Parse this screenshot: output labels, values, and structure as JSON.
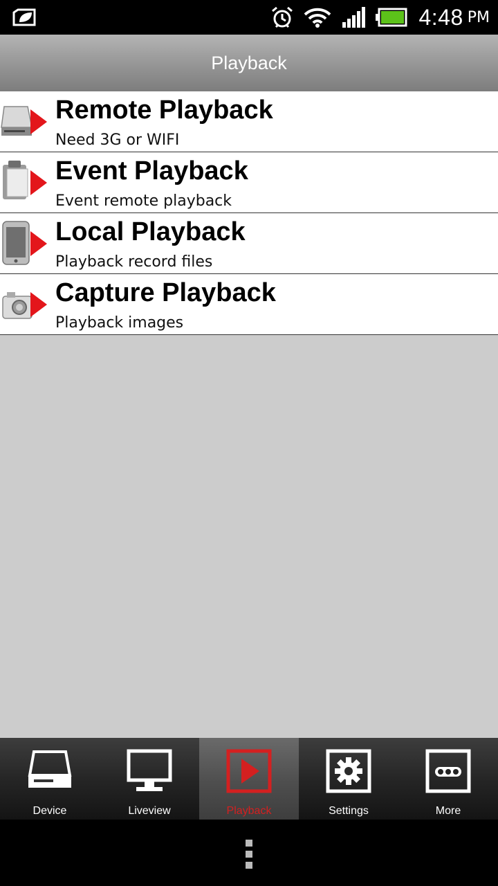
{
  "status_bar": {
    "time": "4:48",
    "ampm": "PM",
    "icons": [
      "leaf-notification-icon",
      "alarm-icon",
      "wifi-icon",
      "signal-icon",
      "battery-icon"
    ]
  },
  "header": {
    "title": "Playback"
  },
  "menu": {
    "items": [
      {
        "title": "Remote Playback",
        "subtitle": "Need 3G or WIFI",
        "icon": "hard-drive-play-icon"
      },
      {
        "title": "Event Playback",
        "subtitle": "Event remote playback",
        "icon": "clipboard-play-icon"
      },
      {
        "title": "Local Playback",
        "subtitle": "Playback record files",
        "icon": "phone-play-icon"
      },
      {
        "title": "Capture Playback",
        "subtitle": "Playback images",
        "icon": "camera-play-icon"
      }
    ]
  },
  "tabs": [
    {
      "label": "Device",
      "icon": "device-icon",
      "active": false
    },
    {
      "label": "Liveview",
      "icon": "monitor-icon",
      "active": false
    },
    {
      "label": "Playback",
      "icon": "play-icon",
      "active": true
    },
    {
      "label": "Settings",
      "icon": "gear-icon",
      "active": false
    },
    {
      "label": "More",
      "icon": "more-dots-icon",
      "active": false
    }
  ],
  "colors": {
    "accent": "#d42020",
    "title_bar": "#9a9a9a",
    "background": "#cccccc"
  }
}
